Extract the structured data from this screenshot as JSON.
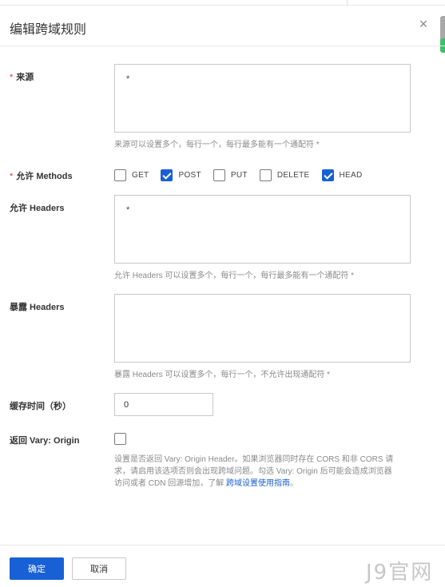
{
  "dialog": {
    "title": "编辑跨域规则",
    "close_icon": "close-icon"
  },
  "origin": {
    "required_mark": "*",
    "label": "来源",
    "value": "*",
    "help": "来源可以设置多个，每行一个，每行最多能有一个通配符 *"
  },
  "methods": {
    "required_mark": "*",
    "label": "允许 Methods",
    "options": [
      {
        "label": "GET",
        "checked": false
      },
      {
        "label": "POST",
        "checked": true
      },
      {
        "label": "PUT",
        "checked": false
      },
      {
        "label": "DELETE",
        "checked": false
      },
      {
        "label": "HEAD",
        "checked": true
      }
    ]
  },
  "allow_headers": {
    "label": "允许 Headers",
    "value": "*",
    "help": "允许 Headers 可以设置多个，每行一个，每行最多能有一个通配符 *"
  },
  "expose_headers": {
    "label": "暴露 Headers",
    "value": "",
    "help": "暴露 Headers 可以设置多个，每行一个，不允许出现通配符 *"
  },
  "cache_time": {
    "label": "缓存时间（秒）",
    "value": "0"
  },
  "vary": {
    "label": "返回 Vary: Origin",
    "checked": false,
    "desc_line1": "设置是否返回 Vary: Origin Header。如果浏览器同时存在 CORS 和非 CORS 请",
    "desc_line2": "求，请启用该选项否则会出现跨域问题。勾选 Vary: Origin 后可能会造成浏览器",
    "desc_line3": "访问或者 CDN 回源增加，了解 ",
    "link": "跨域设置使用指南",
    "desc_end": "。"
  },
  "footer": {
    "ok_label": "确定",
    "cancel_label": "取消"
  },
  "watermark": "J9官网",
  "colors": {
    "primary": "#1860d6",
    "required": "#e03131",
    "scroll_accent": "#3ec06b"
  }
}
